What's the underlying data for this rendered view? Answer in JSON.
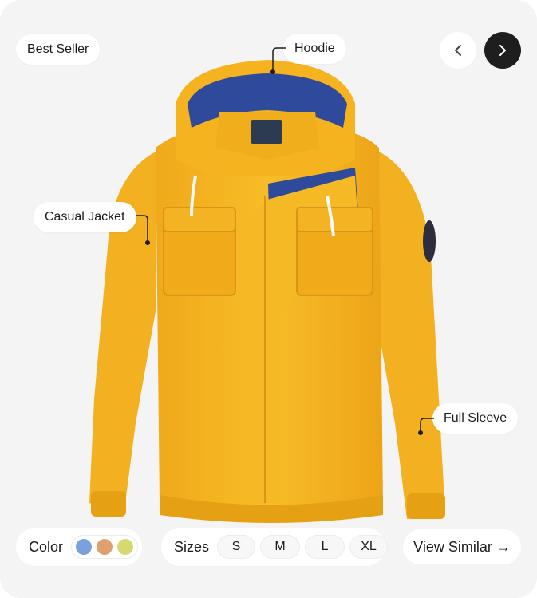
{
  "badges": {
    "best_seller": "Best Seller"
  },
  "callouts": {
    "hoodie": "Hoodie",
    "casual_jacket": "Casual Jacket",
    "full_sleeve": "Full Sleeve"
  },
  "navigation": {
    "prev_icon": "chevron-left-icon",
    "next_icon": "chevron-right-icon"
  },
  "color_selector": {
    "label": "Color",
    "swatches": [
      {
        "name": "blue",
        "hex": "#7aa0e0"
      },
      {
        "name": "tan",
        "hex": "#e0a06e"
      },
      {
        "name": "yellow-green",
        "hex": "#d8d870"
      }
    ]
  },
  "size_selector": {
    "label": "Sizes",
    "options": [
      "S",
      "M",
      "L",
      "XL"
    ]
  },
  "view_similar": {
    "label": "View Similar →"
  },
  "product": {
    "image_icon": "jacket-image",
    "colors": {
      "body": "#f4b51d",
      "body_shadow": "#e19f14",
      "lining": "#2f4a9a",
      "zipper": "#b7b7b7"
    }
  }
}
